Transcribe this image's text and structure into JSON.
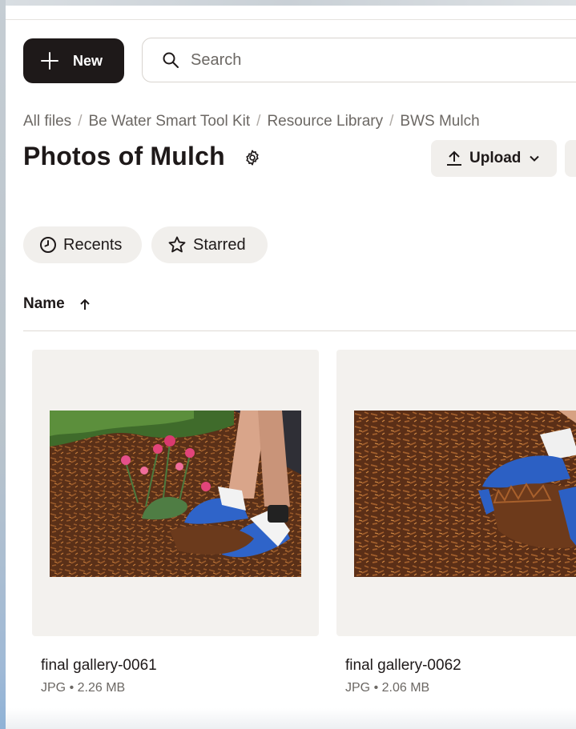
{
  "toolbar": {
    "new_label": "New",
    "search_placeholder": "Search"
  },
  "breadcrumb": [
    "All files",
    "Be Water Smart Tool Kit",
    "Resource Library",
    "BWS Mulch"
  ],
  "folder": {
    "title": "Photos of Mulch",
    "upload_label": "Upload"
  },
  "filters": {
    "recents_label": "Recents",
    "starred_label": "Starred"
  },
  "list": {
    "sort_column": "Name",
    "sort_direction": "ascending"
  },
  "files": [
    {
      "name": "final gallery-0061",
      "meta": "JPG • 2.26 MB"
    },
    {
      "name": "final gallery-0062",
      "meta": "JPG • 2.06 MB"
    }
  ],
  "icons": {
    "new": "plus-icon",
    "search": "search-icon",
    "settings": "gear-icon",
    "upload": "upload-arrow-icon",
    "dropdown": "chevron-down-icon",
    "recents": "clock-icon",
    "starred": "star-icon",
    "sort": "arrow-up-icon"
  },
  "colors": {
    "primary_button": "#1e1919",
    "chip_background": "#f1efec",
    "thumbnail_background": "#f3f1ee",
    "secondary_text": "#6c6864"
  }
}
